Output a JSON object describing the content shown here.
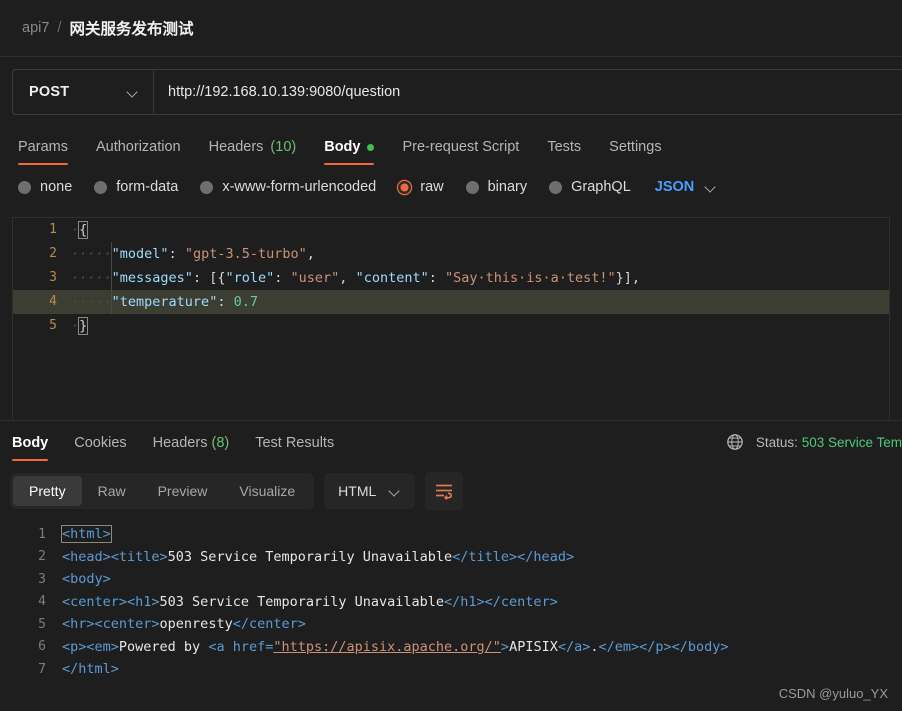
{
  "breadcrumb": {
    "root": "api7",
    "separator": "/",
    "current": "网关服务发布测试"
  },
  "request": {
    "method": "POST",
    "method_chevron_icon": "chevron-down-icon",
    "url": "http://192.168.10.139:9080/question",
    "tabs": [
      {
        "label": "Params",
        "count": "",
        "active": false,
        "dot": false
      },
      {
        "label": "Authorization",
        "count": "",
        "active": false,
        "dot": false
      },
      {
        "label": "Headers",
        "count": "(10)",
        "active": false,
        "dot": false
      },
      {
        "label": "Body",
        "count": "",
        "active": true,
        "dot": true
      },
      {
        "label": "Pre-request Script",
        "count": "",
        "active": false,
        "dot": false
      },
      {
        "label": "Tests",
        "count": "",
        "active": false,
        "dot": false
      },
      {
        "label": "Settings",
        "count": "",
        "active": false,
        "dot": false
      }
    ],
    "body_types": [
      {
        "label": "none",
        "selected": false
      },
      {
        "label": "form-data",
        "selected": false
      },
      {
        "label": "x-www-form-urlencoded",
        "selected": false
      },
      {
        "label": "raw",
        "selected": true
      },
      {
        "label": "binary",
        "selected": false
      },
      {
        "label": "GraphQL",
        "selected": false
      }
    ],
    "raw_format": "JSON",
    "raw_format_chevron_icon": "chevron-down-icon",
    "body_lines": [
      {
        "num": "1",
        "highlight": false
      },
      {
        "num": "2",
        "highlight": false
      },
      {
        "num": "3",
        "highlight": false
      },
      {
        "num": "4",
        "highlight": true
      },
      {
        "num": "5",
        "highlight": false
      }
    ],
    "body_text": {
      "l1_brace": "{",
      "l2_indent": "····",
      "l2_key": "\"model\"",
      "l2_colon": ": ",
      "l2_val": "\"gpt-3.5-turbo\"",
      "l2_end": ",",
      "l3_indent": "····",
      "l3_key": "\"messages\"",
      "l3_colon": ": ",
      "l3_open": "[{",
      "l3_k1": "\"role\"",
      "l3_c1": ": ",
      "l3_v1": "\"user\"",
      "l3_sep": ", ",
      "l3_k2": "\"content\"",
      "l3_c2": ": ",
      "l3_v2": "\"Say·this·is·a·test!\"",
      "l3_close": "}],",
      "l4_indent": "····",
      "l4_key": "\"temperature\"",
      "l4_colon": ": ",
      "l4_val": "0.7",
      "l5_brace": "}"
    }
  },
  "response": {
    "tabs": [
      {
        "label": "Body",
        "count": "",
        "active": true
      },
      {
        "label": "Cookies",
        "count": "",
        "active": false
      },
      {
        "label": "Headers",
        "count": "(8)",
        "active": false
      },
      {
        "label": "Test Results",
        "count": "",
        "active": false
      }
    ],
    "globe_icon": "globe-icon",
    "status_prefix": "Status:",
    "status_value": "503 Service Tem",
    "view_modes": [
      {
        "label": "Pretty",
        "active": true
      },
      {
        "label": "Raw",
        "active": false
      },
      {
        "label": "Preview",
        "active": false
      },
      {
        "label": "Visualize",
        "active": false
      }
    ],
    "format": "HTML",
    "format_chevron_icon": "chevron-down-icon",
    "wrap_icon": "word-wrap-icon",
    "body_lines": [
      {
        "num": "1"
      },
      {
        "num": "2"
      },
      {
        "num": "3"
      },
      {
        "num": "4"
      },
      {
        "num": "5"
      },
      {
        "num": "6"
      },
      {
        "num": "7"
      }
    ],
    "body_text": {
      "l1_tag": "<html>",
      "l2_t1": "<head><title>",
      "l2_txt": "503 Service Temporarily Unavailable",
      "l2_t2": "</title></head>",
      "l3_tag": "<body>",
      "l4_t1": "<center><h1>",
      "l4_txt": "503 Service Temporarily Unavailable",
      "l4_t2": "</h1></center>",
      "l5_t1": "<hr><center>",
      "l5_txt": "openresty",
      "l5_t2": "</center>",
      "l6_t1": "<p><em>",
      "l6_txt1": "Powered by ",
      "l6_t2": "<a href=",
      "l6_url": "\"https://apisix.apache.org/\"",
      "l6_t3": ">",
      "l6_txt2": "APISIX",
      "l6_t4": "</a>",
      "l6_txt3": ".",
      "l6_t5": "</em></p></body>",
      "l7_tag": "</html>"
    }
  },
  "watermark": "CSDN @yuluo_YX",
  "colors": {
    "accent": "#f2693c",
    "link": "#4a9eff",
    "success": "#4ec97a",
    "count": "#6bbf73",
    "bg": "#1e1e1e"
  }
}
